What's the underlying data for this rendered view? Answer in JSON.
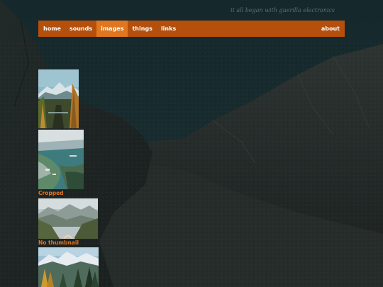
{
  "site": {
    "tagline": "it all began with guerilla electronics"
  },
  "nav": {
    "items": [
      {
        "label": "home",
        "active": false
      },
      {
        "label": "sounds",
        "active": false
      },
      {
        "label": "images",
        "active": true
      },
      {
        "label": "things",
        "active": false
      },
      {
        "label": "links",
        "active": false
      }
    ],
    "right_item": {
      "label": "about"
    }
  },
  "gallery": {
    "items": [
      {
        "caption": "",
        "subject": "mountain-forest-valley"
      },
      {
        "caption": "Cropped",
        "subject": "coastal-city-aerial"
      },
      {
        "caption": "No thumbnail",
        "subject": "misty-mountain-road"
      },
      {
        "caption": "",
        "subject": "alpine-forest"
      }
    ]
  },
  "colors": {
    "accent": "#b44f0c",
    "accent_active": "#e07720",
    "caption": "#e07720",
    "background": "#16282b"
  }
}
